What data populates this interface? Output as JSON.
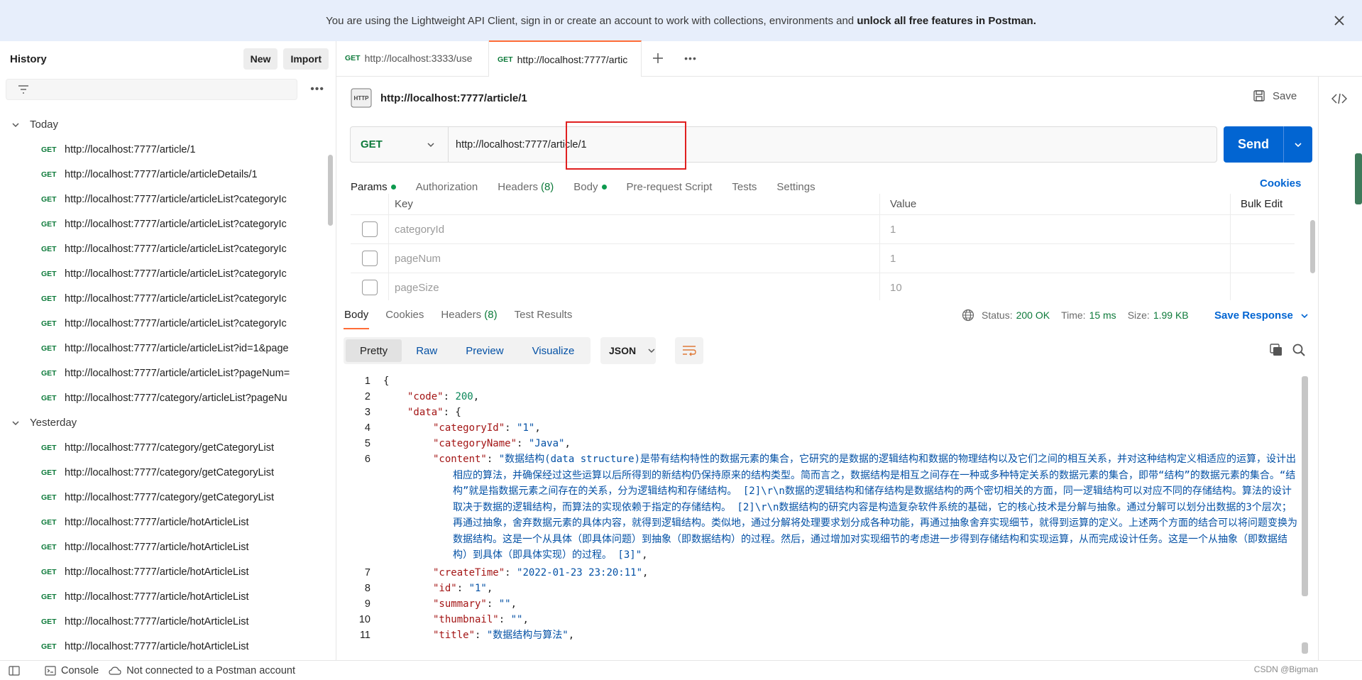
{
  "banner": {
    "text_before": "You are using the Lightweight API Client, sign in or create an account to work with collections, environments and ",
    "text_bold": "unlock all free features in Postman."
  },
  "sidebar": {
    "title": "History",
    "new_label": "New",
    "import_label": "Import",
    "groups": [
      {
        "label": "Today",
        "items": [
          {
            "method": "GET",
            "url": "http://localhost:7777/article/1"
          },
          {
            "method": "GET",
            "url": "http://localhost:7777/article/articleDetails/1"
          },
          {
            "method": "GET",
            "url": "http://localhost:7777/article/articleList?categoryIc"
          },
          {
            "method": "GET",
            "url": "http://localhost:7777/article/articleList?categoryIc"
          },
          {
            "method": "GET",
            "url": "http://localhost:7777/article/articleList?categoryIc"
          },
          {
            "method": "GET",
            "url": "http://localhost:7777/article/articleList?categoryIc"
          },
          {
            "method": "GET",
            "url": "http://localhost:7777/article/articleList?categoryIc"
          },
          {
            "method": "GET",
            "url": "http://localhost:7777/article/articleList?categoryIc"
          },
          {
            "method": "GET",
            "url": "http://localhost:7777/article/articleList?id=1&page"
          },
          {
            "method": "GET",
            "url": "http://localhost:7777/article/articleList?pageNum="
          },
          {
            "method": "GET",
            "url": "http://localhost:7777/category/articleList?pageNu"
          }
        ]
      },
      {
        "label": "Yesterday",
        "items": [
          {
            "method": "GET",
            "url": "http://localhost:7777/category/getCategoryList"
          },
          {
            "method": "GET",
            "url": "http://localhost:7777/category/getCategoryList"
          },
          {
            "method": "GET",
            "url": "http://localhost:7777/category/getCategoryList"
          },
          {
            "method": "GET",
            "url": "http://localhost:7777/article/hotArticleList"
          },
          {
            "method": "GET",
            "url": "http://localhost:7777/article/hotArticleList"
          },
          {
            "method": "GET",
            "url": "http://localhost:7777/article/hotArticleList"
          },
          {
            "method": "GET",
            "url": "http://localhost:7777/article/hotArticleList"
          },
          {
            "method": "GET",
            "url": "http://localhost:7777/article/hotArticleList"
          },
          {
            "method": "GET",
            "url": "http://localhost:7777/article/hotArticleList"
          }
        ]
      }
    ]
  },
  "tabs": [
    {
      "method": "GET",
      "label": "http://localhost:3333/use"
    },
    {
      "method": "GET",
      "label": "http://localhost:7777/artic"
    }
  ],
  "request": {
    "title": "http://localhost:7777/article/1",
    "save_label": "Save",
    "method": "GET",
    "url": "http://localhost:7777/article/1",
    "send_label": "Send",
    "tabs": {
      "params": "Params",
      "authorization": "Authorization",
      "headers": "Headers",
      "headers_count": "(8)",
      "body": "Body",
      "prerequest": "Pre-request Script",
      "tests": "Tests",
      "settings": "Settings"
    },
    "cookies_label": "Cookies",
    "params_header": {
      "key": "Key",
      "value": "Value",
      "bulk": "Bulk Edit"
    },
    "params": [
      {
        "key": "categoryId",
        "value": "1"
      },
      {
        "key": "pageNum",
        "value": "1"
      },
      {
        "key": "pageSize",
        "value": "10"
      }
    ]
  },
  "response": {
    "tabs": {
      "body": "Body",
      "cookies": "Cookies",
      "headers": "Headers",
      "headers_count": "(8)",
      "test_results": "Test Results"
    },
    "status_label": "Status:",
    "status_value": "200 OK",
    "time_label": "Time:",
    "time_value": "15 ms",
    "size_label": "Size:",
    "size_value": "1.99 KB",
    "save_response_label": "Save Response",
    "views": {
      "pretty": "Pretty",
      "raw": "Raw",
      "preview": "Preview",
      "visualize": "Visualize"
    },
    "format": "JSON",
    "lines": {
      "l1": "{",
      "l2_key": "\"code\"",
      "l2_val": "200",
      "l3_key": "\"data\"",
      "l4_key": "\"categoryId\"",
      "l4_val": "\"1\"",
      "l5_key": "\"categoryName\"",
      "l5_val": "\"Java\"",
      "l6_key": "\"content\"",
      "l6_val": "\"数据结构(data structure)是带有结构特性的数据元素的集合，它研究的是数据的逻辑结构和数据的物理结构以及它们之间的相互关系，并对这种结构定义相适应的运算，设计出相应的算法，并确保经过这些运算以后所得到的新结构仍保持原来的结构类型。简而言之，数据结构是相互之间存在一种或多种特定关系的数据元素的集合，即带“结构”的数据元素的集合。“结构”就是指数据元素之间存在的关系，分为逻辑结构和存储结构。 [2]\\r\\n数据的逻辑结构和储存结构是数据结构的两个密切相关的方面，同一逻辑结构可以对应不同的存储结构。算法的设计取决于数据的逻辑结构，而算法的实现依赖于指定的存储结构。 [2]\\r\\n数据结构的研究内容是构造复杂软件系统的基础，它的核心技术是分解与抽象。通过分解可以划分出数据的3个层次；再通过抽象，舍弃数据元素的具体内容，就得到逻辑结构。类似地，通过分解将处理要求划分成各种功能，再通过抽象舍弃实现细节，就得到运算的定义。上述两个方面的结合可以将问题变换为数据结构。这是一个从具体（即具体问题）到抽象（即数据结构）的过程。然后，通过增加对实现细节的考虑进一步得到存储结构和实现运算，从而完成设计任务。这是一个从抽象（即数据结构）到具体（即具体实现）的过程。 [3]\"",
      "l7_key": "\"createTime\"",
      "l7_val": "\"2022-01-23 23:20:11\"",
      "l8_key": "\"id\"",
      "l8_val": "\"1\"",
      "l9_key": "\"summary\"",
      "l9_val": "\"\"",
      "l10_key": "\"thumbnail\"",
      "l10_val": "\"\"",
      "l11_key": "\"title\"",
      "l11_val": "\"数据结构与算法\""
    }
  },
  "footer": {
    "console_label": "Console",
    "account_label": "Not connected to a Postman account",
    "watermark": "CSDN @Bigman"
  }
}
